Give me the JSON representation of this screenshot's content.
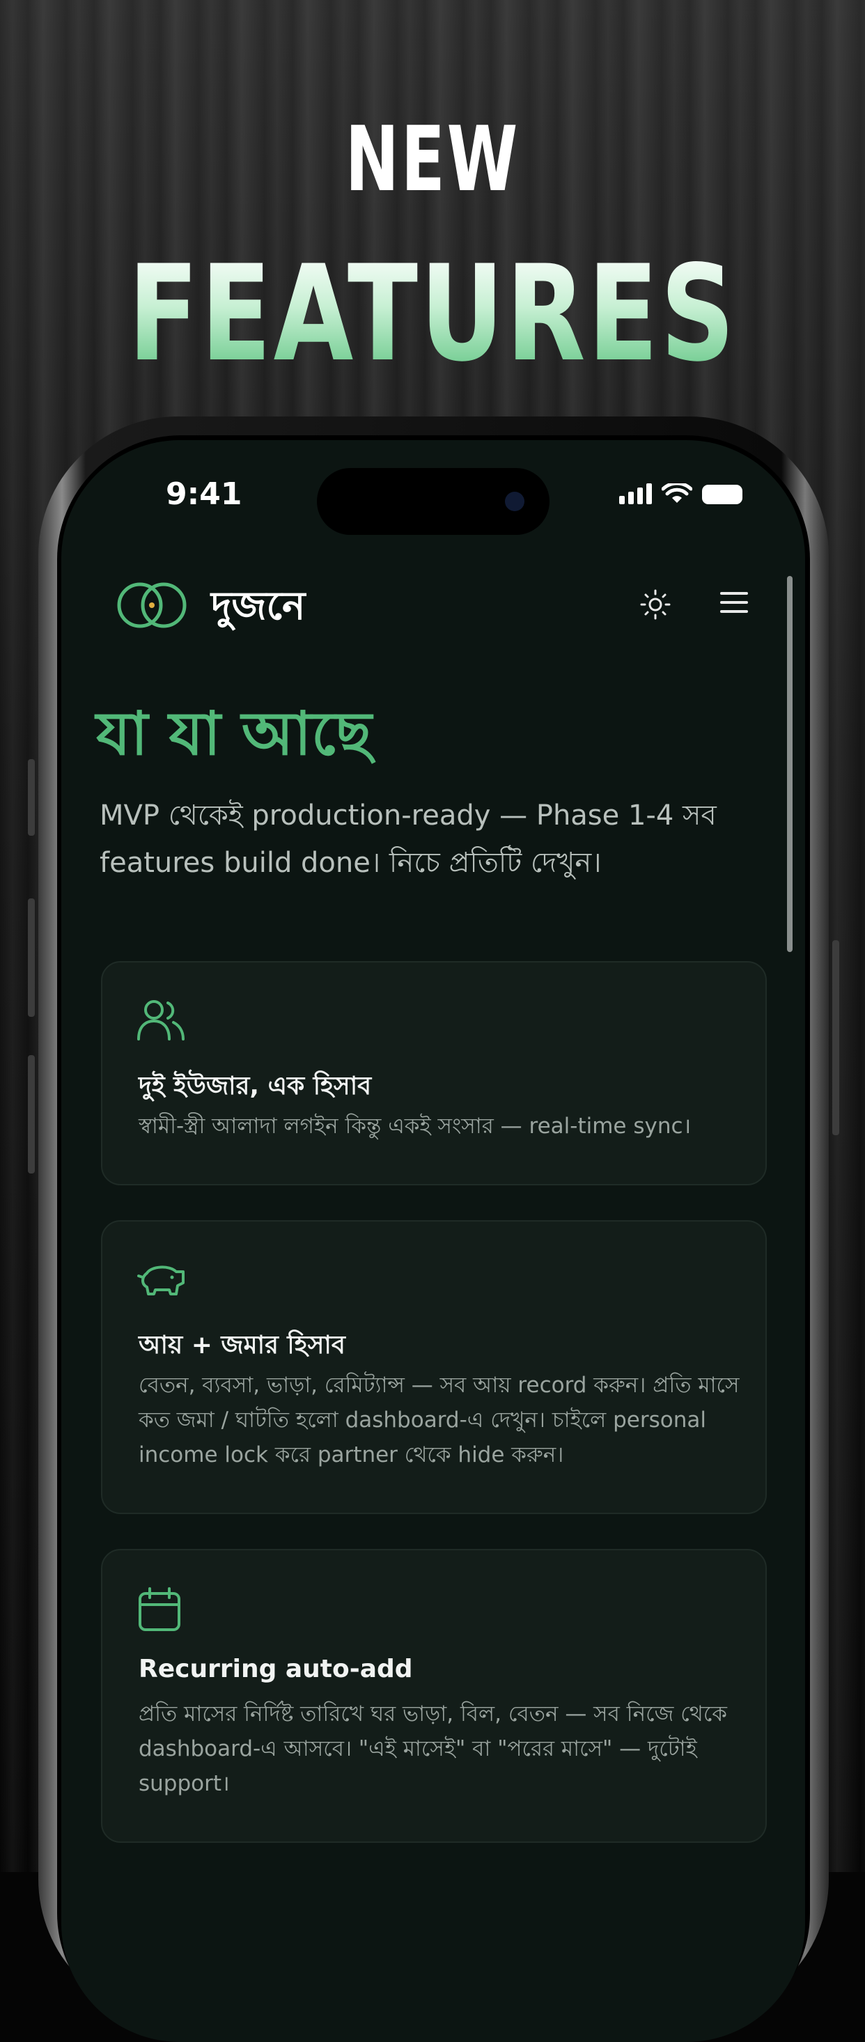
{
  "promo": {
    "line1": "NEW",
    "line2": "FEATURES"
  },
  "status_bar": {
    "time": "9:41"
  },
  "app": {
    "brand": "দুজনে"
  },
  "page": {
    "title": "যা যা আছে",
    "intro": "MVP থেকেই production-ready — Phase 1-4 সব features build done। নিচে প্রতিটি দেখুন।"
  },
  "features": [
    {
      "icon": "users-icon",
      "title": "দুই ইউজার, এক হিসাব",
      "desc": "স্বামী-স্ত্রী আলাদা লগইন কিন্তু একই সংসার — real-time sync।"
    },
    {
      "icon": "piggy-bank-icon",
      "title": "আয় + জমার হিসাব",
      "desc": "বেতন, ব্যবসা, ভাড়া, রেমিট্যান্স — সব আয় record করুন। প্রতি মাসে কত জমা / ঘাটতি হলো dashboard-এ দেখুন। চাইলে personal income lock করে partner থেকে hide করুন।"
    },
    {
      "icon": "calendar-icon",
      "title": "Recurring auto-add",
      "desc": "প্রতি মাসের নির্দিষ্ট তারিখে ঘর ভাড়া, বিল, বেতন — সব নিজে থেকে dashboard-এ আসবে। \"এই মাসেই\" বা \"পরের মাসে\" — দুটোই support।"
    }
  ],
  "colors": {
    "accent": "#52b878",
    "background": "#0c1512",
    "card": "#131d19"
  }
}
